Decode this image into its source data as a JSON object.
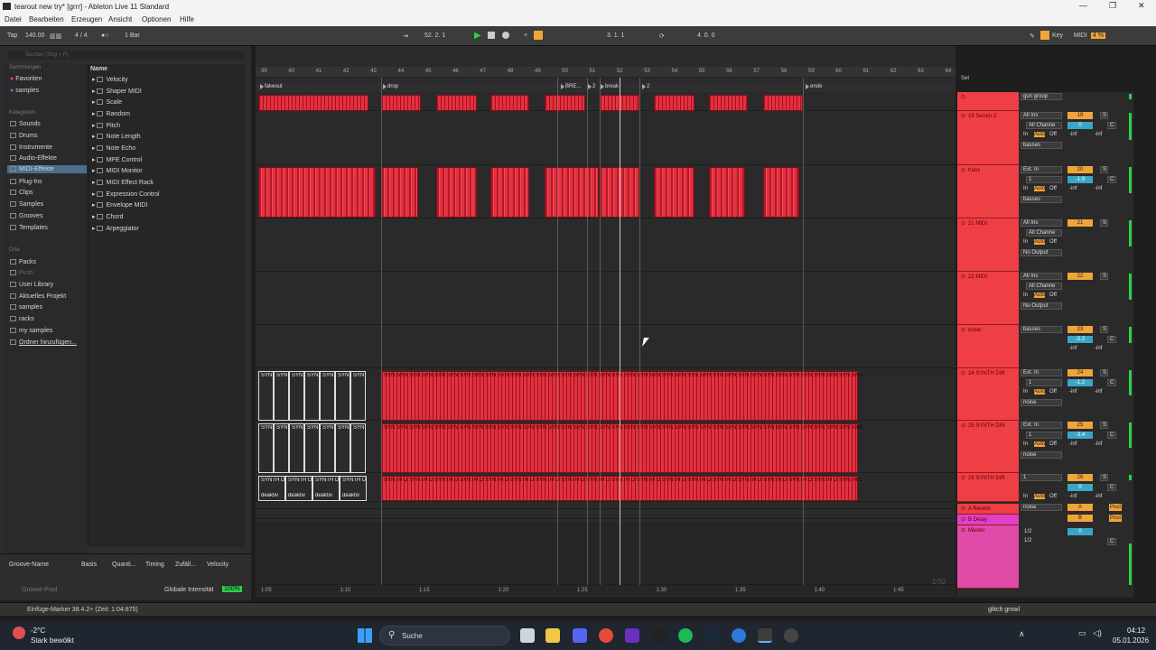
{
  "window": {
    "title": "tearout new try* [grrr] - Ableton Live 11 Standard"
  },
  "menu": [
    "Datei",
    "Bearbeiten",
    "Erzeugen",
    "Ansicht",
    "Optionen",
    "Hilfe"
  ],
  "transport": {
    "tap": "Tap",
    "tempo": "140.00",
    "time_sig": "4 / 4",
    "quant": "1 Bar",
    "position": "52.  2.  1",
    "loop_start": "3.  1.  1",
    "loop_len": "4.  0.  0",
    "key": "Key",
    "midi": "MIDI",
    "cpu": "4 %"
  },
  "browser": {
    "search_placeholder": "Suchen (Strg + F)",
    "section_collections": "Sammlungen",
    "collections": [
      "Favoriten",
      "samples"
    ],
    "section_categories": "Kategorien",
    "categories": [
      "Sounds",
      "Drums",
      "Instrumente",
      "Audio-Effekte",
      "MIDI-Effekte",
      "Plug-Ins",
      "Clips",
      "Samples",
      "Grooves",
      "Templates"
    ],
    "section_places": "Orte",
    "places": [
      "Packs",
      "Push",
      "User Library",
      "Aktuelles Projekt",
      "samples",
      "racks",
      "my samples",
      "Ordner hinzufügen..."
    ],
    "name_header": "Name",
    "items": [
      "Velocity",
      "Shaper MIDI",
      "Scale",
      "Random",
      "Pitch",
      "Note Length",
      "Note Echo",
      "MPE Control",
      "MIDI Monitor",
      "MIDI Effect Rack",
      "Expression Control",
      "Envelope MIDI",
      "Chord",
      "Arpeggiator"
    ]
  },
  "groove": {
    "headers": [
      "Groove-Name",
      "Basis",
      "Quanti...",
      "Timing",
      "Zufäll...",
      "Velocity"
    ],
    "pool": "Groove-Pool",
    "global_label": "Globale Intensität",
    "global_value": "100%"
  },
  "ruler": [
    "39",
    "40",
    "41",
    "42",
    "43",
    "44",
    "45",
    "46",
    "47",
    "48",
    "49",
    "50",
    "51",
    "52",
    "53",
    "54",
    "55",
    "56",
    "57",
    "58",
    "59",
    "60",
    "61",
    "62",
    "63",
    "64"
  ],
  "locators": [
    "fakeout",
    "drop",
    "BRE...",
    "2",
    "break",
    "2",
    "ende"
  ],
  "clip_labels": {
    "syn": "SYN",
    "synth_d": "SYNTH D",
    "deakt": "deaktiv"
  },
  "timeline": [
    "1:05",
    "1:10",
    "1:15",
    "1:20",
    "1:25",
    "1:30",
    "1:35",
    "1:40",
    "1:45"
  ],
  "set_label": "Set",
  "fraction": "1/32",
  "tracks": [
    {
      "name": "",
      "input": "gun group",
      "num": ""
    },
    {
      "name": "19 Serum 2",
      "input": "All Ins",
      "chan": "All Channe",
      "out": "basses",
      "num": "19",
      "vol": "0",
      "pan": "C",
      "inf1": "-inf",
      "inf2": "-inf"
    },
    {
      "name": "trans",
      "input": "Ext. In",
      "chan": "1",
      "out": "basses",
      "num": "20",
      "vol": "-1.9",
      "pan": "C",
      "inf1": "-inf",
      "inf2": "-inf"
    },
    {
      "name": "21 MIDI",
      "input": "All Ins",
      "chan": "All Channe",
      "out": "No Output",
      "num": "21"
    },
    {
      "name": "22 MIDI",
      "input": "All Ins",
      "chan": "All Channe",
      "out": "No Output",
      "num": "22"
    },
    {
      "name": "noise",
      "input": "basses",
      "num": "23",
      "vol": "-2.2",
      "pan": "C",
      "inf1": "-inf",
      "inf2": "-inf"
    },
    {
      "name": "24 SYNTH DIR",
      "input": "Ext. In",
      "chan": "1",
      "out": "noise",
      "num": "24",
      "vol": "-1.2",
      "pan": "C",
      "inf1": "-inf",
      "inf2": "-inf"
    },
    {
      "name": "25 SYNTH DIR",
      "input": "Ext. In",
      "chan": "1",
      "out": "noise",
      "num": "25",
      "vol": "-3.4",
      "pan": "C",
      "inf1": "-inf",
      "inf2": "-inf"
    },
    {
      "name": "26 SYNTH DIR",
      "input": "1",
      "out": "noise",
      "num": "26",
      "vol": "0",
      "pan": "C",
      "inf1": "-inf",
      "inf2": "-inf"
    }
  ],
  "returns": [
    {
      "name": "A Reverb",
      "letter": "A",
      "post": "Post"
    },
    {
      "name": "B Delay",
      "letter": "B",
      "post": "Post"
    }
  ],
  "master": {
    "name": "Master",
    "in1": "1/2",
    "in2": "1/2",
    "vol": "0",
    "pan": "C"
  },
  "mixer_labels": {
    "in": "In",
    "auto": "Auto",
    "off": "Off",
    "s": "S"
  },
  "status": {
    "text": "Einfüge-Marker 38.4.2+ (Zeit: 1:04:875)",
    "right": "glitch growl"
  },
  "taskbar": {
    "weather_temp": "-2°C",
    "weather_desc": "Stark bewölkt",
    "search": "Suche",
    "time": "04:12",
    "date": "05.01.2026"
  },
  "colors": {
    "clip_red": "#e2323f",
    "track_red": "#f03e45",
    "delay_pink": "#e040c8",
    "master_pink": "#e04aa8",
    "accent_orange": "#f0a43a"
  }
}
